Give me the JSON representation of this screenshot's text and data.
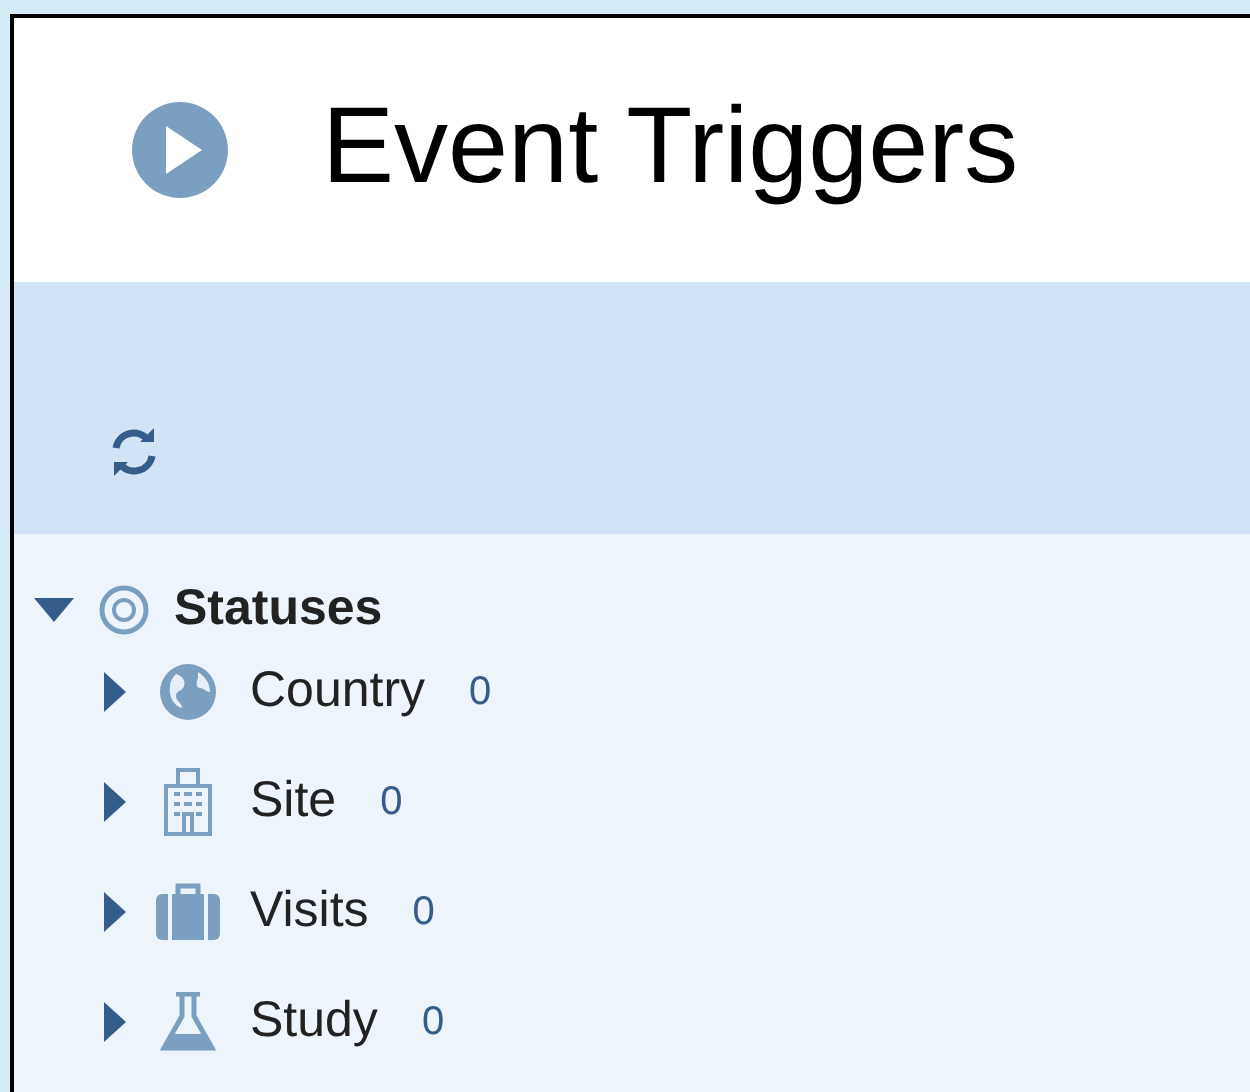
{
  "header": {
    "title": "Event Triggers"
  },
  "tree": [
    {
      "label": "Statuses",
      "kind": "statuses",
      "expanded": true,
      "children": [
        {
          "label": "Country",
          "kind": "globe",
          "count": "0",
          "expanded": false
        },
        {
          "label": "Site",
          "kind": "building",
          "count": "0",
          "expanded": false
        },
        {
          "label": "Visits",
          "kind": "suitcase",
          "count": "0",
          "expanded": false
        },
        {
          "label": "Study",
          "kind": "flask",
          "count": "0",
          "expanded": false
        }
      ]
    }
  ]
}
